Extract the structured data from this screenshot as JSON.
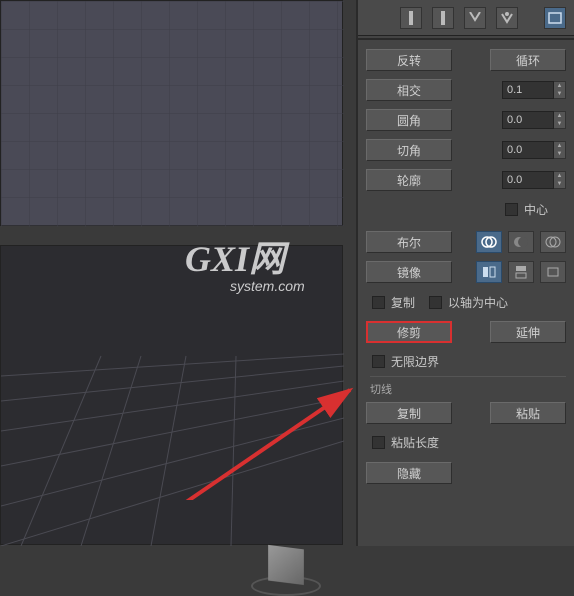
{
  "toolbar": {
    "icons": [
      "tool1",
      "tool2",
      "tool3",
      "tool4",
      "tool5",
      "tool6"
    ]
  },
  "props": {
    "reverse": "反转",
    "cycle": "循环",
    "intersect": "相交",
    "intersect_val": "0.1",
    "fillet": "圆角",
    "fillet_val": "0.0",
    "chamfer": "切角",
    "chamfer_val": "0.0",
    "outline": "轮廓",
    "outline_val": "0.0",
    "center": "中心",
    "boolean": "布尔",
    "mirror": "镜像",
    "copy": "复制",
    "axis_center": "以轴为中心",
    "trim": "修剪",
    "extend": "延伸",
    "infinite": "无限边界",
    "tangent_section": "切线",
    "copy2": "复制",
    "paste": "粘贴",
    "paste_length": "粘贴长度",
    "hide": "隐藏"
  },
  "watermark": {
    "main": "GXI网",
    "sub": "system.com"
  }
}
